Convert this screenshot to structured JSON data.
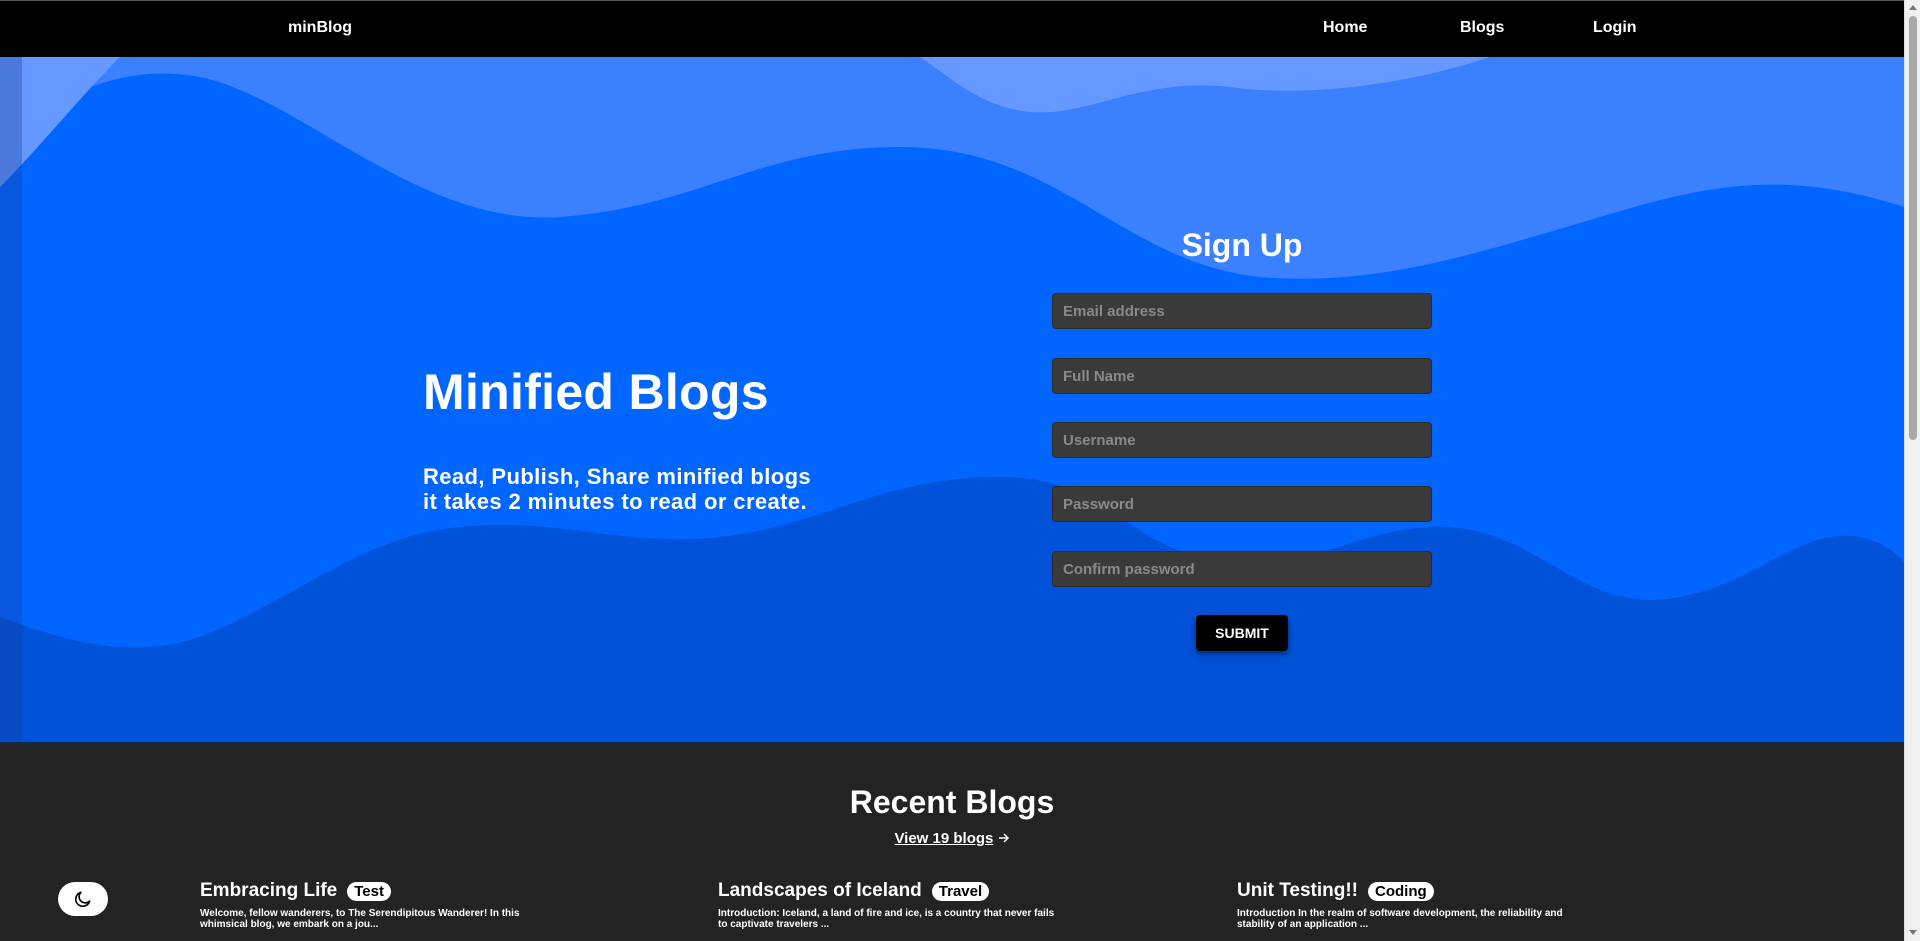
{
  "nav": {
    "brand": "minBlog",
    "links": [
      "Home",
      "Blogs",
      "Login"
    ]
  },
  "hero": {
    "title": "Minified Blogs",
    "subtitle_line1": "Read, Publish, Share minified blogs",
    "subtitle_line2": "it takes 2 minutes to read or create."
  },
  "signup": {
    "title": "Sign Up",
    "email_placeholder": "Email address",
    "fullname_placeholder": "Full Name",
    "username_placeholder": "Username",
    "password_placeholder": "Password",
    "confirm_placeholder": "Confirm password",
    "submit_label": "SUBMIT"
  },
  "recent": {
    "title": "Recent Blogs",
    "view_label": "View 19 blogs",
    "blogs": [
      {
        "title": "Embracing Life",
        "tag": "Test",
        "excerpt": "Welcome, fellow wanderers, to The Serendipitous Wanderer! In this whimsical blog, we embark on a jou..."
      },
      {
        "title": "Landscapes of Iceland",
        "tag": "Travel",
        "excerpt": "Introduction: Iceland, a land of fire and ice, is a country that never fails to captivate travelers ..."
      },
      {
        "title": "Unit Testing!!",
        "tag": "Coding",
        "excerpt": "Introduction In the realm of software development, the reliability and stability of an application ..."
      }
    ]
  },
  "icons": {
    "theme_toggle": "moon-icon",
    "view_arrow": "arrow-right-icon"
  },
  "colors": {
    "hero_bg": "#0066ff",
    "navbar_bg": "#000000",
    "page_bg": "#232323",
    "field_bg": "#3a3a3a"
  }
}
